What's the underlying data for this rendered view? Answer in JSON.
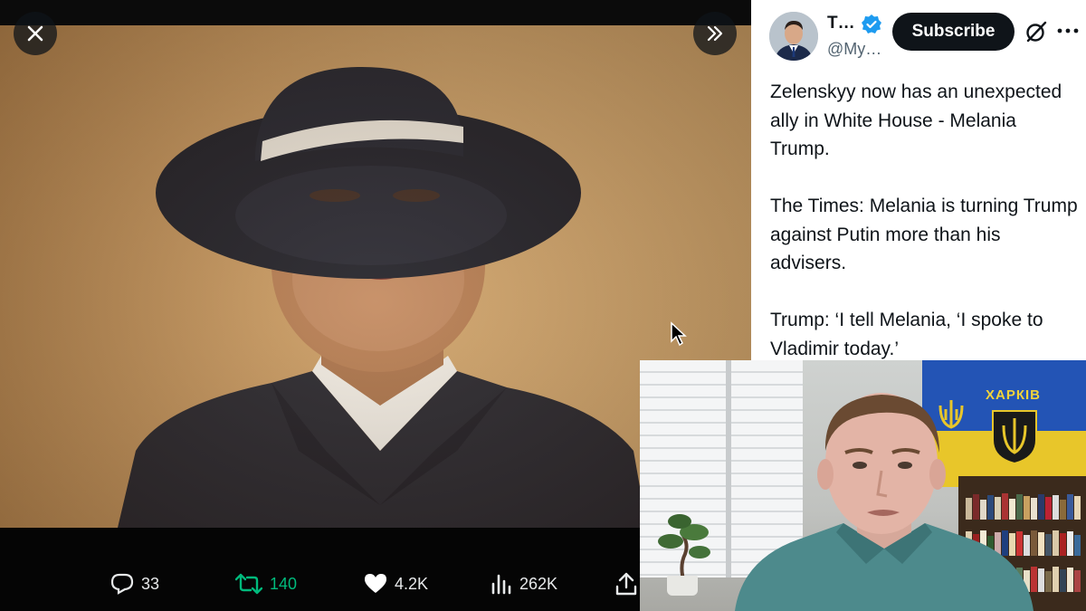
{
  "viewer": {
    "close_icon": "close-icon",
    "expand_icon": "chevron-double-right-icon",
    "photo_alt": "Woman in a wide-brimmed navy hat with white band and navy coat, smiling"
  },
  "actions": {
    "reply_count": "33",
    "retweet_count": "140",
    "like_count": "4.2K",
    "views_count": "262K",
    "icons": [
      "reply-icon",
      "retweet-icon",
      "heart-icon",
      "views-icon",
      "share-icon"
    ],
    "retweet_color": "#00ba7c"
  },
  "tweet": {
    "author_name": "T…",
    "author_handle": "@My…",
    "subscribe_label": "Subscribe",
    "verified_color": "#1d9bf0",
    "paragraphs": [
      "Zelenskyy now has an unexpected ally in White House - Melania Trump.",
      "The Times: Melania is turning Trump against Putin more than his advisers.",
      "Trump: ‘I tell Melania, ‘I spoke to Vladimir today.’"
    ]
  },
  "webcam": {
    "flag_text": "ХАРКІВ"
  }
}
